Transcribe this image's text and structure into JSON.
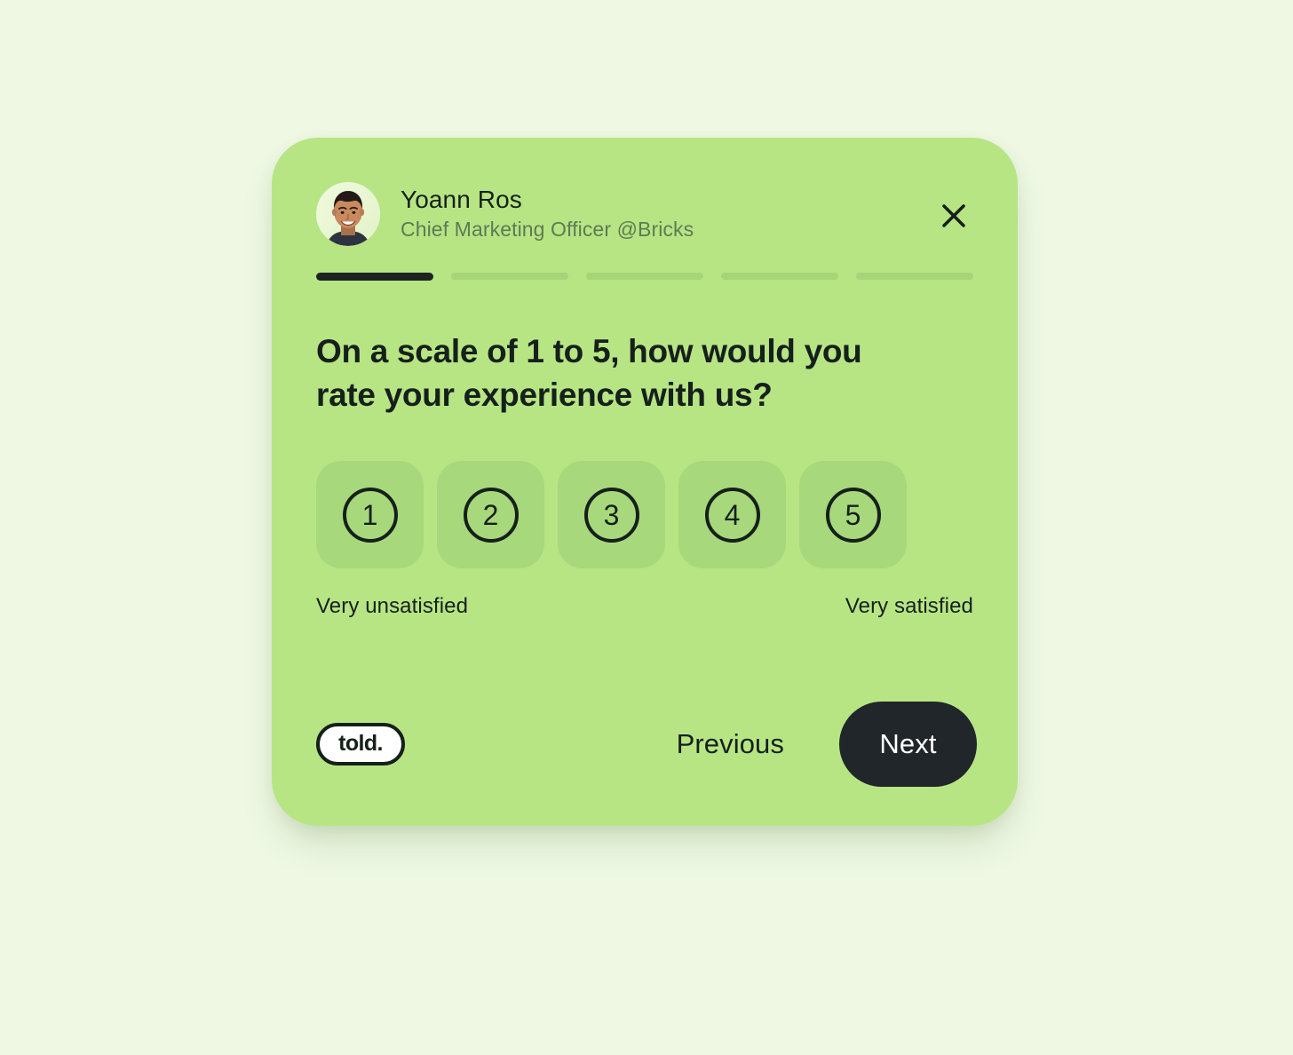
{
  "theme": {
    "page_background": "#eef8e3",
    "card_background": "#b7e584",
    "rating_tile_background": "#a7d87b",
    "progress_inactive": "#a6d479",
    "progress_active": "#1d2321",
    "ink": "#16201b",
    "muted_text": "#5f7a54",
    "next_button_background": "#20262a",
    "next_button_text": "#ffffff"
  },
  "header": {
    "avatar_icon": "user-avatar-photo",
    "name": "Yoann Ros",
    "role": "Chief Marketing Officer @Bricks",
    "close_icon": "close-icon"
  },
  "progress": {
    "total_steps": 5,
    "current_step": 1,
    "segments": [
      {
        "state": "active"
      },
      {
        "state": "inactive"
      },
      {
        "state": "inactive"
      },
      {
        "state": "inactive"
      },
      {
        "state": "inactive"
      }
    ]
  },
  "question": {
    "text": "On a scale of 1 to 5, how would you rate your experience with us?"
  },
  "rating": {
    "options": [
      {
        "value": "1"
      },
      {
        "value": "2"
      },
      {
        "value": "3"
      },
      {
        "value": "4"
      },
      {
        "value": "5"
      }
    ],
    "low_label": "Very unsatisfied",
    "high_label": "Very satisfied",
    "selected": null
  },
  "footer": {
    "brand_label": "told.",
    "previous_label": "Previous",
    "next_label": "Next"
  }
}
